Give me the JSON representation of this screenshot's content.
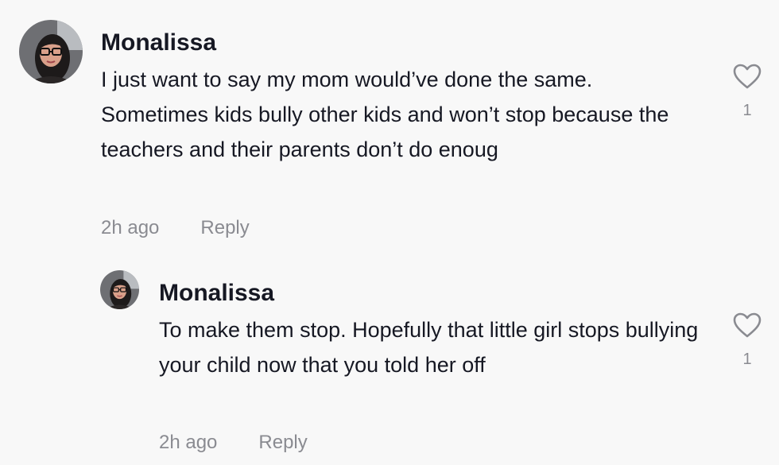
{
  "comment": {
    "username": "Monalissa",
    "text": "I just want to say my mom would’ve done the same. Sometimes kids bully other kids and won’t stop because the teachers and their parents don’t do enoug",
    "time": "2h ago",
    "reply_label": "Reply",
    "like_icon": "heart-outline-icon",
    "like_count": "1"
  },
  "reply": {
    "username": "Monalissa",
    "text": "To make them stop. Hopefully that little girl stops bullying your child now that you told her off",
    "time": "2h ago",
    "reply_label": "Reply",
    "like_icon": "heart-outline-icon",
    "like_count": "1"
  },
  "colors": {
    "background": "#f8f8f8",
    "text_primary": "#161823",
    "text_secondary": "#8a8b91"
  }
}
